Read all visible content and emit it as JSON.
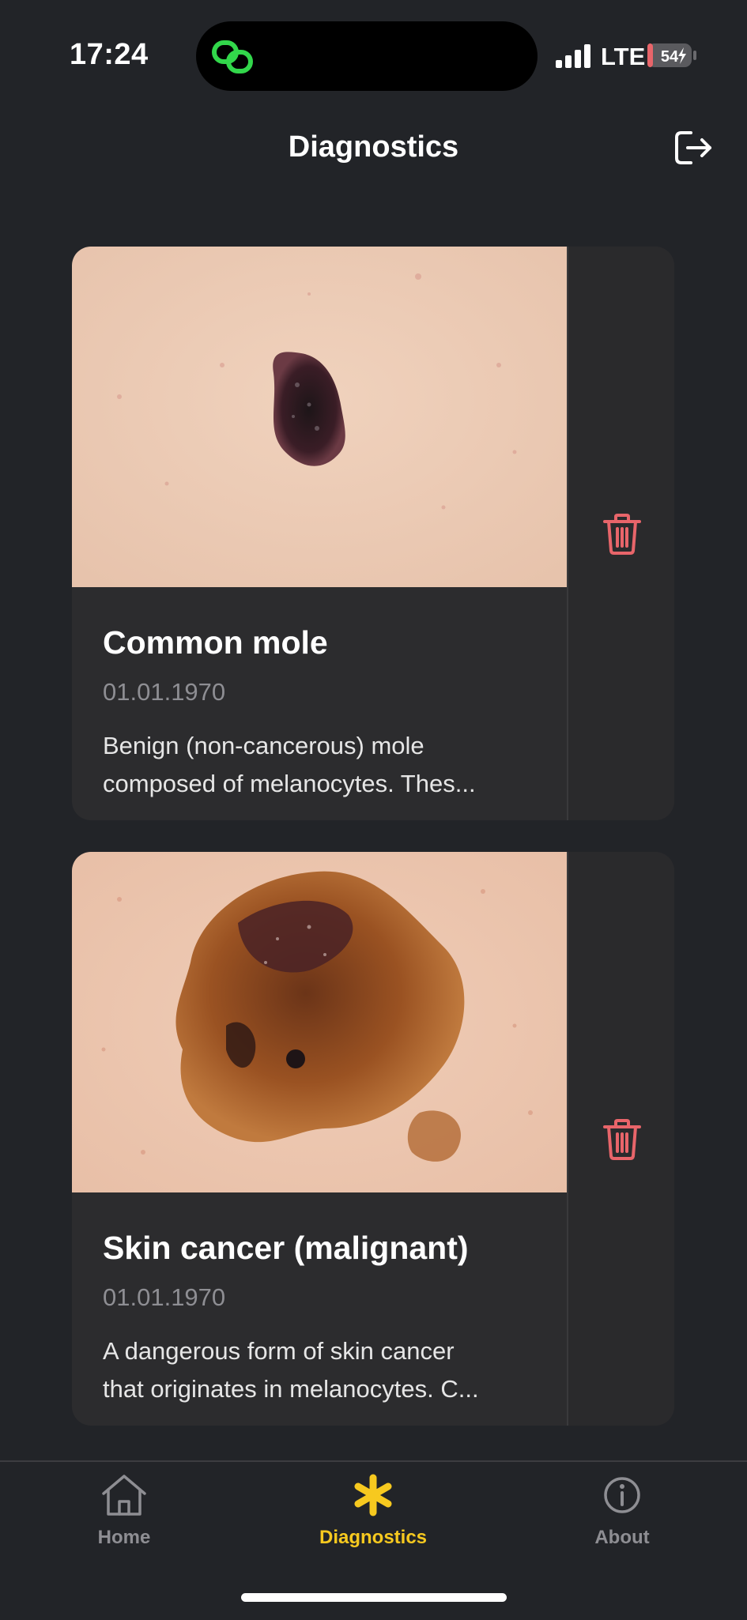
{
  "status_bar": {
    "time": "17:24",
    "network": "LTE",
    "battery": "54"
  },
  "header": {
    "title": "Diagnostics"
  },
  "diagnoses": [
    {
      "title": "Common mole",
      "date": "01.01.1970",
      "description_lines": [
        "Benign (non-cancerous) mole",
        "composed of melanocytes. Thes..."
      ]
    },
    {
      "title": "Skin cancer (malignant)",
      "date": "01.01.1970",
      "description_lines": [
        "A dangerous form of skin cancer",
        "that originates in melanocytes. C..."
      ]
    }
  ],
  "tabs": [
    {
      "label": "Home",
      "icon": "house-icon",
      "active": false
    },
    {
      "label": "Diagnostics",
      "icon": "asterisk-icon",
      "active": true
    },
    {
      "label": "About",
      "icon": "info-icon",
      "active": false
    }
  ],
  "colors": {
    "background": "#222428",
    "card": "#2c2c2e",
    "accent": "#f7c91f",
    "danger": "#e8656a"
  }
}
